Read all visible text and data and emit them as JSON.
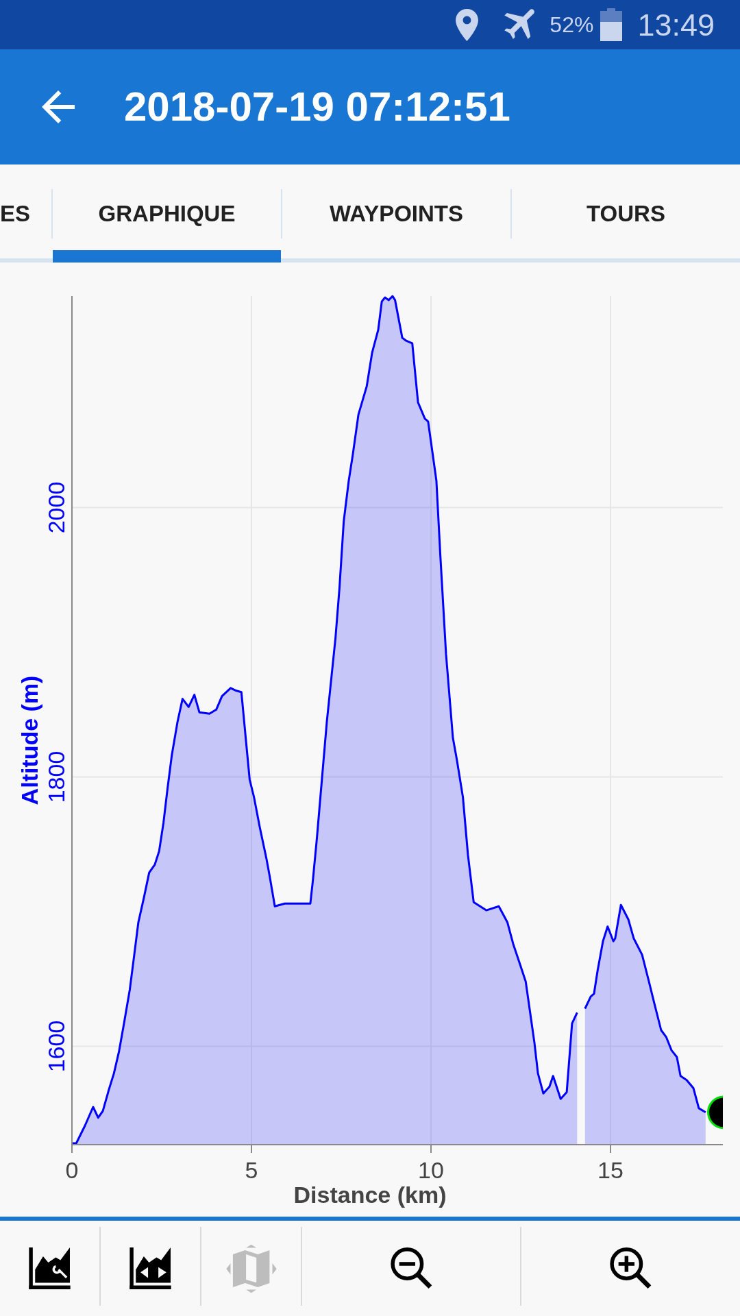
{
  "status_bar": {
    "battery": "52%",
    "time": "13:49"
  },
  "app_bar": {
    "title": "2018-07-19 07:12:51"
  },
  "tabs": [
    {
      "label": "ES",
      "selected": false
    },
    {
      "label": "GRAPHIQUE",
      "selected": true
    },
    {
      "label": "WAYPOINTS",
      "selected": false
    },
    {
      "label": "TOURS",
      "selected": false
    }
  ],
  "chart": {
    "chart_data": {
      "type": "area",
      "xlabel": "Distance (km)",
      "ylabel": "Altitude (m)",
      "x": [
        0,
        0.12,
        0.36,
        0.59,
        0.73,
        0.86,
        1.03,
        1.17,
        1.31,
        1.45,
        1.61,
        1.73,
        1.85,
        2.01,
        2.15,
        2.31,
        2.43,
        2.55,
        2.66,
        2.78,
        2.94,
        3.08,
        3.25,
        3.41,
        3.55,
        3.83,
        4.02,
        4.18,
        4.42,
        4.58,
        4.72,
        4.84,
        4.95,
        5.07,
        5.23,
        5.42,
        5.51,
        5.65,
        5.93,
        6.4,
        6.64,
        6.71,
        6.82,
        6.92,
        7.1,
        7.34,
        7.45,
        7.57,
        7.71,
        7.82,
        7.98,
        8.21,
        8.36,
        8.53,
        8.63,
        8.72,
        8.82,
        8.93,
        9.0,
        9.2,
        9.3,
        9.48,
        9.64,
        9.83,
        9.92,
        10.15,
        10.26,
        10.42,
        10.61,
        10.72,
        10.89,
        11.03,
        11.19,
        11.54,
        11.89,
        12.13,
        12.29,
        12.48,
        12.64,
        12.88,
        12.98,
        13.13,
        13.3,
        13.4,
        13.61,
        13.78,
        13.93,
        14.07,
        14.29,
        14.45,
        14.54,
        14.64,
        14.79,
        14.92,
        15.08,
        15.13,
        15.29,
        15.5,
        15.65,
        15.88,
        16.07,
        16.22,
        16.41,
        16.55,
        16.7,
        16.85,
        16.95,
        17.12,
        17.31,
        17.46,
        17.65
      ],
      "series": [
        {
          "color": "#0000ff",
          "values": [
            1528,
            1528,
            1541,
            1555,
            1547,
            1552,
            1568,
            1580,
            1596,
            1617,
            1642,
            1667,
            1692,
            1711,
            1729,
            1735,
            1745,
            1766,
            1791,
            1816,
            1841,
            1858,
            1852,
            1861,
            1848,
            1847,
            1850,
            1860,
            1866,
            1864,
            1863,
            1829,
            1798,
            1785,
            1763,
            1739,
            1726,
            1704,
            1706,
            1706,
            1706,
            1723,
            1754,
            1785,
            1841,
            1903,
            1940,
            1990,
            2020,
            2039,
            2069,
            2090,
            2115,
            2132,
            2153,
            2156,
            2154,
            2157,
            2154,
            2126,
            2124,
            2122,
            2078,
            2066,
            2064,
            2020,
            1965,
            1891,
            1829,
            1813,
            1785,
            1742,
            1707,
            1701,
            1704,
            1692,
            1676,
            1661,
            1648,
            1603,
            1580,
            1565,
            1570,
            1578,
            1561,
            1566,
            1617,
            1625,
            null,
            null,
            null,
            null,
            null,
            null,
            null,
            null,
            null,
            null,
            null,
            null,
            null,
            null,
            null,
            null,
            null,
            null,
            null,
            null,
            null,
            null,
            null
          ]
        },
        {
          "color": "#0000ff",
          "values": [
            null,
            null,
            null,
            null,
            null,
            null,
            null,
            null,
            null,
            null,
            null,
            null,
            null,
            null,
            null,
            null,
            null,
            null,
            null,
            null,
            null,
            null,
            null,
            null,
            null,
            null,
            null,
            null,
            null,
            null,
            null,
            null,
            null,
            null,
            null,
            null,
            null,
            null,
            null,
            null,
            null,
            null,
            null,
            null,
            null,
            null,
            null,
            null,
            null,
            null,
            null,
            null,
            null,
            null,
            null,
            null,
            null,
            null,
            null,
            null,
            null,
            null,
            null,
            null,
            null,
            null,
            null,
            null,
            null,
            null,
            null,
            null,
            null,
            null,
            null,
            null,
            null,
            null,
            null,
            null,
            null,
            null,
            null,
            null,
            null,
            null,
            null,
            null,
            1628,
            1637,
            1639,
            1656,
            1678,
            1689,
            1678,
            1680,
            1705,
            1694,
            1680,
            1668,
            1648,
            1632,
            1612,
            1607,
            1597,
            1592,
            1578,
            1575,
            1569,
            1554,
            1551
          ]
        }
      ],
      "xlim": [
        0,
        18.13
      ],
      "ylim": [
        1527,
        2157
      ],
      "xticks": [
        0,
        5,
        10,
        15
      ],
      "yticks": [
        1600,
        1800,
        2000
      ],
      "grid": true
    }
  },
  "toolbar": {
    "buttons": [
      {
        "disabled": false
      },
      {
        "disabled": false
      },
      {
        "disabled": true
      },
      {
        "disabled": false
      },
      {
        "disabled": false
      }
    ]
  }
}
